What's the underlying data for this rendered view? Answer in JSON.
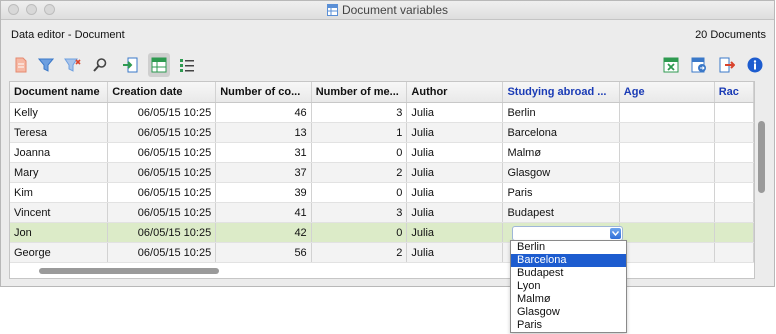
{
  "window": {
    "title": "Document variables"
  },
  "subtitle": "Data editor - Document",
  "doc_count": "20 Documents",
  "toolbar_left": [
    {
      "name": "new-document-icon",
      "color": "#f0a089"
    },
    {
      "name": "filter-icon",
      "color": "#5a8fd6"
    },
    {
      "name": "remove-filter-icon",
      "color": "#5a8fd6"
    },
    {
      "name": "search-icon",
      "color": "#555555"
    },
    {
      "name": "import-icon",
      "color": "#2e9a50"
    },
    {
      "name": "table-view-icon",
      "color": "#2e9a50"
    },
    {
      "name": "list-view-icon",
      "color": "#2e9a50"
    }
  ],
  "toolbar_right": [
    {
      "name": "excel-export-icon",
      "color": "#2e9a50"
    },
    {
      "name": "export-variables-icon",
      "color": "#3a78c8"
    },
    {
      "name": "exit-icon",
      "color": "#d9432c"
    },
    {
      "name": "info-icon",
      "color": "#1d5ccf"
    }
  ],
  "table": {
    "columns": [
      "Document name",
      "Creation date",
      "Number of co...",
      "Number of me...",
      "Author",
      "Studying abroad ...",
      "Age",
      "Rac"
    ],
    "rows": [
      [
        "Kelly",
        "06/05/15 10:25",
        "46",
        "3",
        "Julia",
        "Berlin",
        "",
        ""
      ],
      [
        "Teresa",
        "06/05/15 10:25",
        "13",
        "1",
        "Julia",
        "Barcelona",
        "",
        ""
      ],
      [
        "Joanna",
        "06/05/15 10:25",
        "31",
        "0",
        "Julia",
        "Malmø",
        "",
        ""
      ],
      [
        "Mary",
        "06/05/15 10:25",
        "37",
        "2",
        "Julia",
        "Glasgow",
        "",
        ""
      ],
      [
        "Kim",
        "06/05/15 10:25",
        "39",
        "0",
        "Julia",
        "Paris",
        "",
        ""
      ],
      [
        "Vincent",
        "06/05/15 10:25",
        "41",
        "3",
        "Julia",
        "Budapest",
        "",
        ""
      ],
      [
        "Jon",
        "06/05/15 10:25",
        "42",
        "0",
        "Julia",
        "",
        "",
        ""
      ],
      [
        "George",
        "06/05/15 10:25",
        "56",
        "2",
        "Julia",
        "",
        "",
        ""
      ]
    ],
    "selected_row": 6
  },
  "dropdown": {
    "options": [
      "Berlin",
      "Barcelona",
      "Budapest",
      "Lyon",
      "Malmø",
      "Glasgow",
      "Paris"
    ],
    "highlighted": 1
  }
}
